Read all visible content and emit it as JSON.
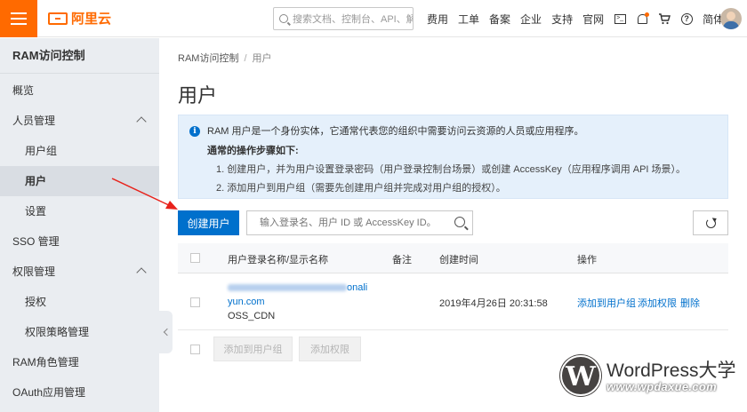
{
  "topbar": {
    "brand": "阿里云",
    "search_placeholder": "搜索文档、控制台、API、解决方案和资源",
    "nav": [
      "费用",
      "工单",
      "备案",
      "企业",
      "支持",
      "官网"
    ],
    "language": "简体",
    "icons": [
      "menu-icon",
      "terminal-icon",
      "bell-icon",
      "cart-icon",
      "help-icon"
    ],
    "accent_color": "#ff6a00"
  },
  "sidebar": {
    "title": "RAM访问控制",
    "items": [
      {
        "label": "概览",
        "level": 1
      },
      {
        "label": "人员管理",
        "level": 1,
        "expanded": true
      },
      {
        "label": "用户组",
        "level": 2
      },
      {
        "label": "用户",
        "level": 2,
        "active": true
      },
      {
        "label": "设置",
        "level": 2
      },
      {
        "label": "SSO 管理",
        "level": 1
      },
      {
        "label": "权限管理",
        "level": 1,
        "expanded": true
      },
      {
        "label": "授权",
        "level": 2
      },
      {
        "label": "权限策略管理",
        "level": 2
      },
      {
        "label": "RAM角色管理",
        "level": 1
      },
      {
        "label": "OAuth应用管理",
        "level": 1
      }
    ]
  },
  "breadcrumb": {
    "root": "RAM访问控制",
    "separator": "/",
    "current": "用户"
  },
  "page_title": "用户",
  "info": {
    "intro": "RAM 用户是一个身份实体，它通常代表您的组织中需要访问云资源的人员或应用程序。",
    "steps_title": "通常的操作步骤如下:",
    "steps": [
      "1. 创建用户，并为用户设置登录密码（用户登录控制台场景）或创建 AccessKey（应用程序调用 API 场景）。",
      "2. 添加用户到用户组（需要先创建用户组并完成对用户组的授权）。"
    ]
  },
  "toolbar": {
    "create_label": "创建用户",
    "search_placeholder": "输入登录名、用户 ID 或 AccessKey ID。",
    "primary_color": "#0070cc"
  },
  "table": {
    "headers": {
      "name": "用户登录名称/显示名称",
      "note": "备注",
      "created": "创建时间",
      "actions": "操作"
    },
    "rows": [
      {
        "login_suffix": "onali",
        "login_line2": "yun.com",
        "display_name": "OSS_CDN",
        "note": "",
        "created": "2019年4月26日 20:31:58",
        "actions": [
          "添加到用户组",
          "添加权限",
          "删除"
        ]
      }
    ],
    "footer_buttons": [
      "添加到用户组",
      "添加权限"
    ]
  },
  "watermark": {
    "title": "WordPress大学",
    "url": "www.wpdaxue.com"
  }
}
